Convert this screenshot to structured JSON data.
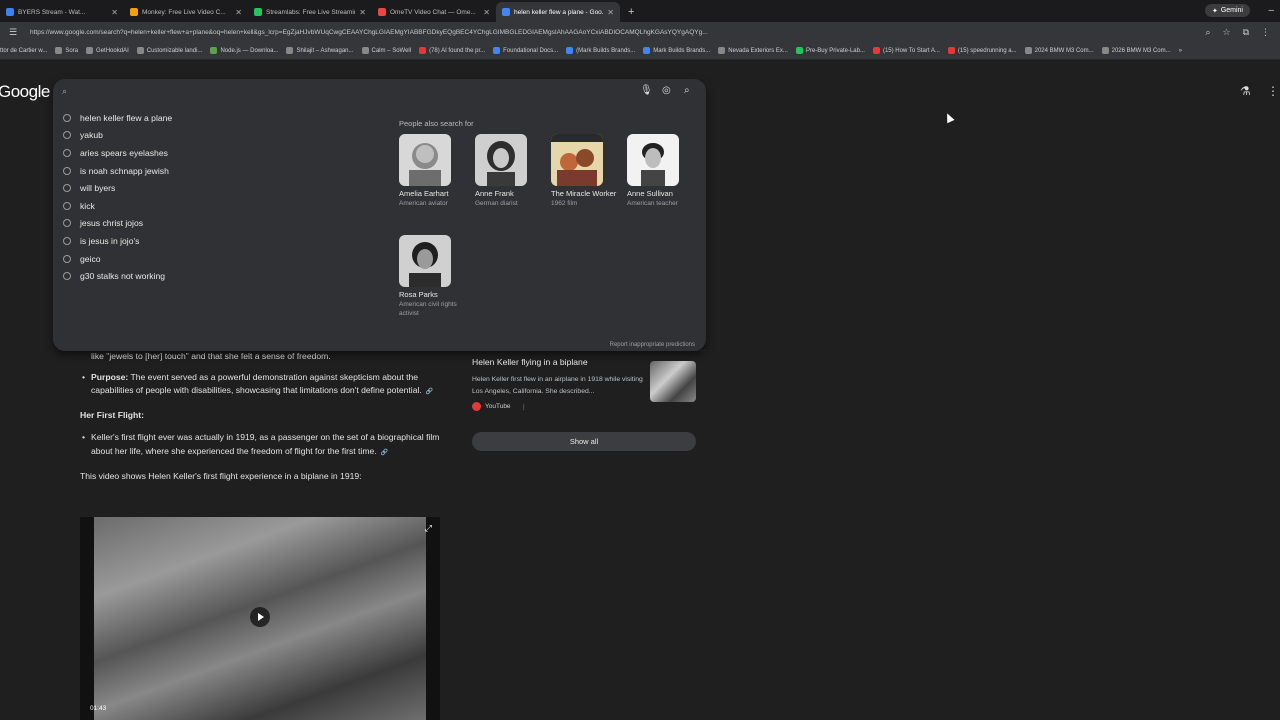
{
  "tabs": [
    {
      "label": "BYERS Stream - Wat...",
      "color": "#3b82f6",
      "active": false
    },
    {
      "label": "Monkey: Free Live Video C...",
      "color": "#f59e0b",
      "active": false
    },
    {
      "label": "Streamlabs: Free Live Streaming...",
      "color": "#22c55e",
      "active": false
    },
    {
      "label": "OmeTV Video Chat — Ome...",
      "color": "#ef4444",
      "active": false
    },
    {
      "label": "helen keller flew a plane - Goo...",
      "color": "#4285f4",
      "active": true
    }
  ],
  "gemini_label": "Gemini",
  "url": "https://www.google.com/search?q=helen+keller+flew+a+plane&oq=helen+kell&gs_lcrp=EgZjaHJvbWUqCwgCEAAYChgLGIAEMgYIABBFGDkyEQgBEC4YChgLGIMBGLEDGIAEMgsIAhAAGAoYCxiABDIOCAMQLhgKGAsYQYgAQYg...",
  "bookmarks": [
    "ttor de Cartier w...",
    "Sora",
    "GetHookdAI",
    "Customizable landi...",
    "Node.js — Downloa...",
    "Shilajit – Ashwagan...",
    "Calm – SoWell",
    "(78) AI found the pr...",
    "Foundational Docs...",
    "(Mark Builds Brands...",
    "Mark Builds Brands...",
    "Nevada Exteriors Ex...",
    "Pre-Buy Private-Lab...",
    "(15) How To Start A...",
    "(15) speedrunning a...",
    "2024 BMW M3 Com...",
    "2026 BMW M3 Com..."
  ],
  "logo_text": "Google",
  "search": {
    "query": ""
  },
  "suggestions": [
    "helen keller flew a plane",
    "yakub",
    "aries spears eyelashes",
    "is noah schnapp jewish",
    "will byers",
    "kick",
    "jesus christ jojos",
    "is jesus in jojo's",
    "geico",
    "g30 stalks not working"
  ],
  "people_also_search": {
    "title": "People also search for",
    "people": [
      {
        "name": "Amelia Earhart",
        "desc": "American aviator"
      },
      {
        "name": "Anne Frank",
        "desc": "German diarist"
      },
      {
        "name": "The Miracle Worker",
        "desc": "1962 film"
      },
      {
        "name": "Anne Sullivan",
        "desc": "American teacher"
      },
      {
        "name": "Rosa Parks",
        "desc": "American civil rights activist"
      }
    ]
  },
  "report_text": "Report inappropriate predictions",
  "content": {
    "line1": "like \"jewels to [her] touch\" and that she felt a sense of freedom.",
    "purpose_label": "Purpose:",
    "purpose_text": " The event served as a powerful demonstration against skepticism about the capabilities of people with disabilities, showcasing that limitations don't define potential.",
    "first_flight_heading": "Her First Flight:",
    "first_flight_text": "Keller's first flight ever was actually in 1919, as a passenger on the set of a biographical film about her life, where she experienced the freedom of flight for the first time.",
    "video_intro": "This video shows Helen Keller's first flight experience in a biplane in 1919:",
    "video_duration": "01:43"
  },
  "side": {
    "title": "Helen Keller flying in a biplane",
    "snippet": "Helen Keller first flew in an airplane in 1918 while visiting Los Angeles, California. She described...",
    "source": "YouTube",
    "show_all": "Show all"
  }
}
